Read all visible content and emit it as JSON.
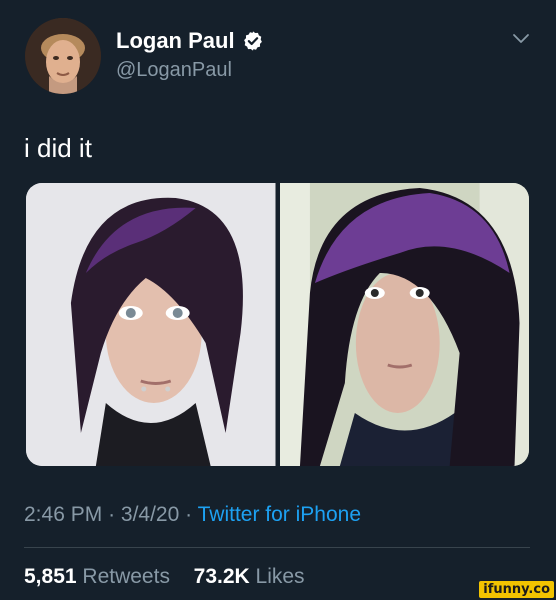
{
  "user": {
    "display_name": "Logan Paul",
    "handle": "@LoganPaul",
    "verified": true
  },
  "tweet": {
    "text": "i did it",
    "media_count": 2
  },
  "meta": {
    "time": "2:46 PM",
    "separator": "·",
    "date": "3/4/20",
    "source": "Twitter for iPhone"
  },
  "stats": {
    "retweets_count": "5,851",
    "retweets_label": "Retweets",
    "likes_count": "73.2K",
    "likes_label": "Likes"
  },
  "watermark": "ifunny.co",
  "colors": {
    "background": "#15202b",
    "secondary_text": "#8899a6",
    "link": "#1da1f2",
    "divider": "#38444d",
    "verified_badge": "#ffffff"
  }
}
